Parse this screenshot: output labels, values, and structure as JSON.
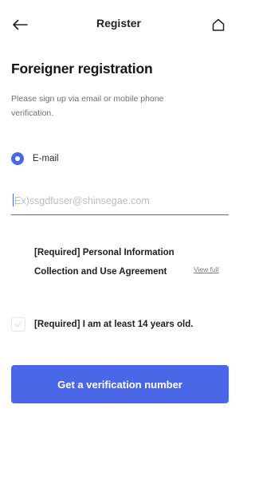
{
  "header": {
    "title": "Register",
    "back_icon": "arrow-left-icon",
    "home_icon": "home-icon"
  },
  "main": {
    "title": "Foreigner registration",
    "description": "Please sign up via email or mobile phone verification.",
    "method": {
      "label": "E-mail",
      "selected": true
    },
    "email_input": {
      "value": "",
      "placeholder": "Ex)ssgdfuser@shinsegae.com"
    },
    "agreement": {
      "label": "[Required] Personal Information Collection and Use Agreement",
      "view_full": "View full"
    },
    "age_check": {
      "label": "[Required] I am at least 14 years old.",
      "checked": false
    },
    "submit_button": "Get a verification number"
  },
  "colors": {
    "accent": "#4a67e8",
    "text": "#1a1a1a",
    "muted": "#6f6f6f",
    "placeholder": "#bdbdbd"
  }
}
